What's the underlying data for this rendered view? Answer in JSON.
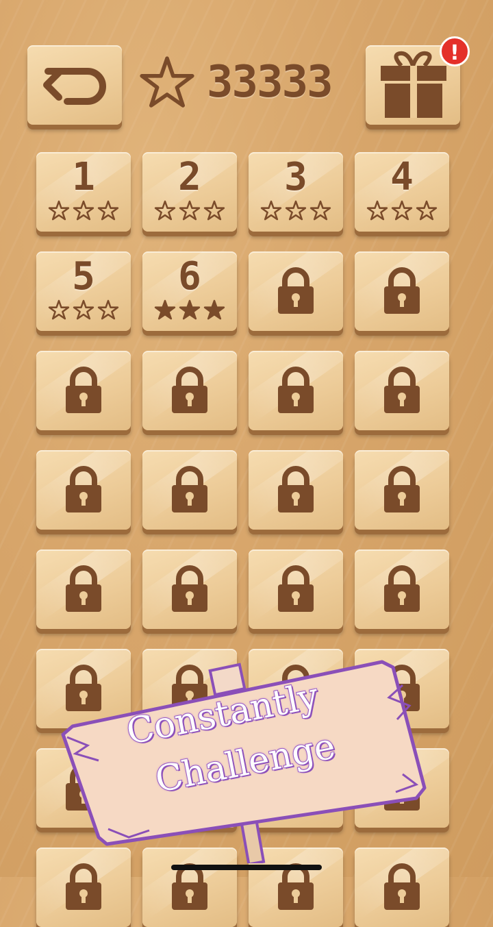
{
  "header": {
    "back_icon": "back-arrow-icon",
    "star_icon": "star-outline-icon",
    "score": "33333",
    "gift_icon": "gift-icon",
    "gift_badge": "!"
  },
  "levels": [
    {
      "number": "1",
      "locked": false,
      "stars_filled": 0
    },
    {
      "number": "2",
      "locked": false,
      "stars_filled": 0
    },
    {
      "number": "3",
      "locked": false,
      "stars_filled": 0
    },
    {
      "number": "4",
      "locked": false,
      "stars_filled": 0
    },
    {
      "number": "5",
      "locked": false,
      "stars_filled": 0
    },
    {
      "number": "6",
      "locked": false,
      "stars_filled": 3
    }
  ],
  "locked_icon": "padlock-icon",
  "banner": {
    "line1": "Constantly",
    "line2": "Challenge"
  },
  "colors": {
    "wood_dark": "#7a4b2a",
    "tile": "#edcc99",
    "banner_text_stroke": "#9a5cc6",
    "badge": "#e4302a"
  }
}
